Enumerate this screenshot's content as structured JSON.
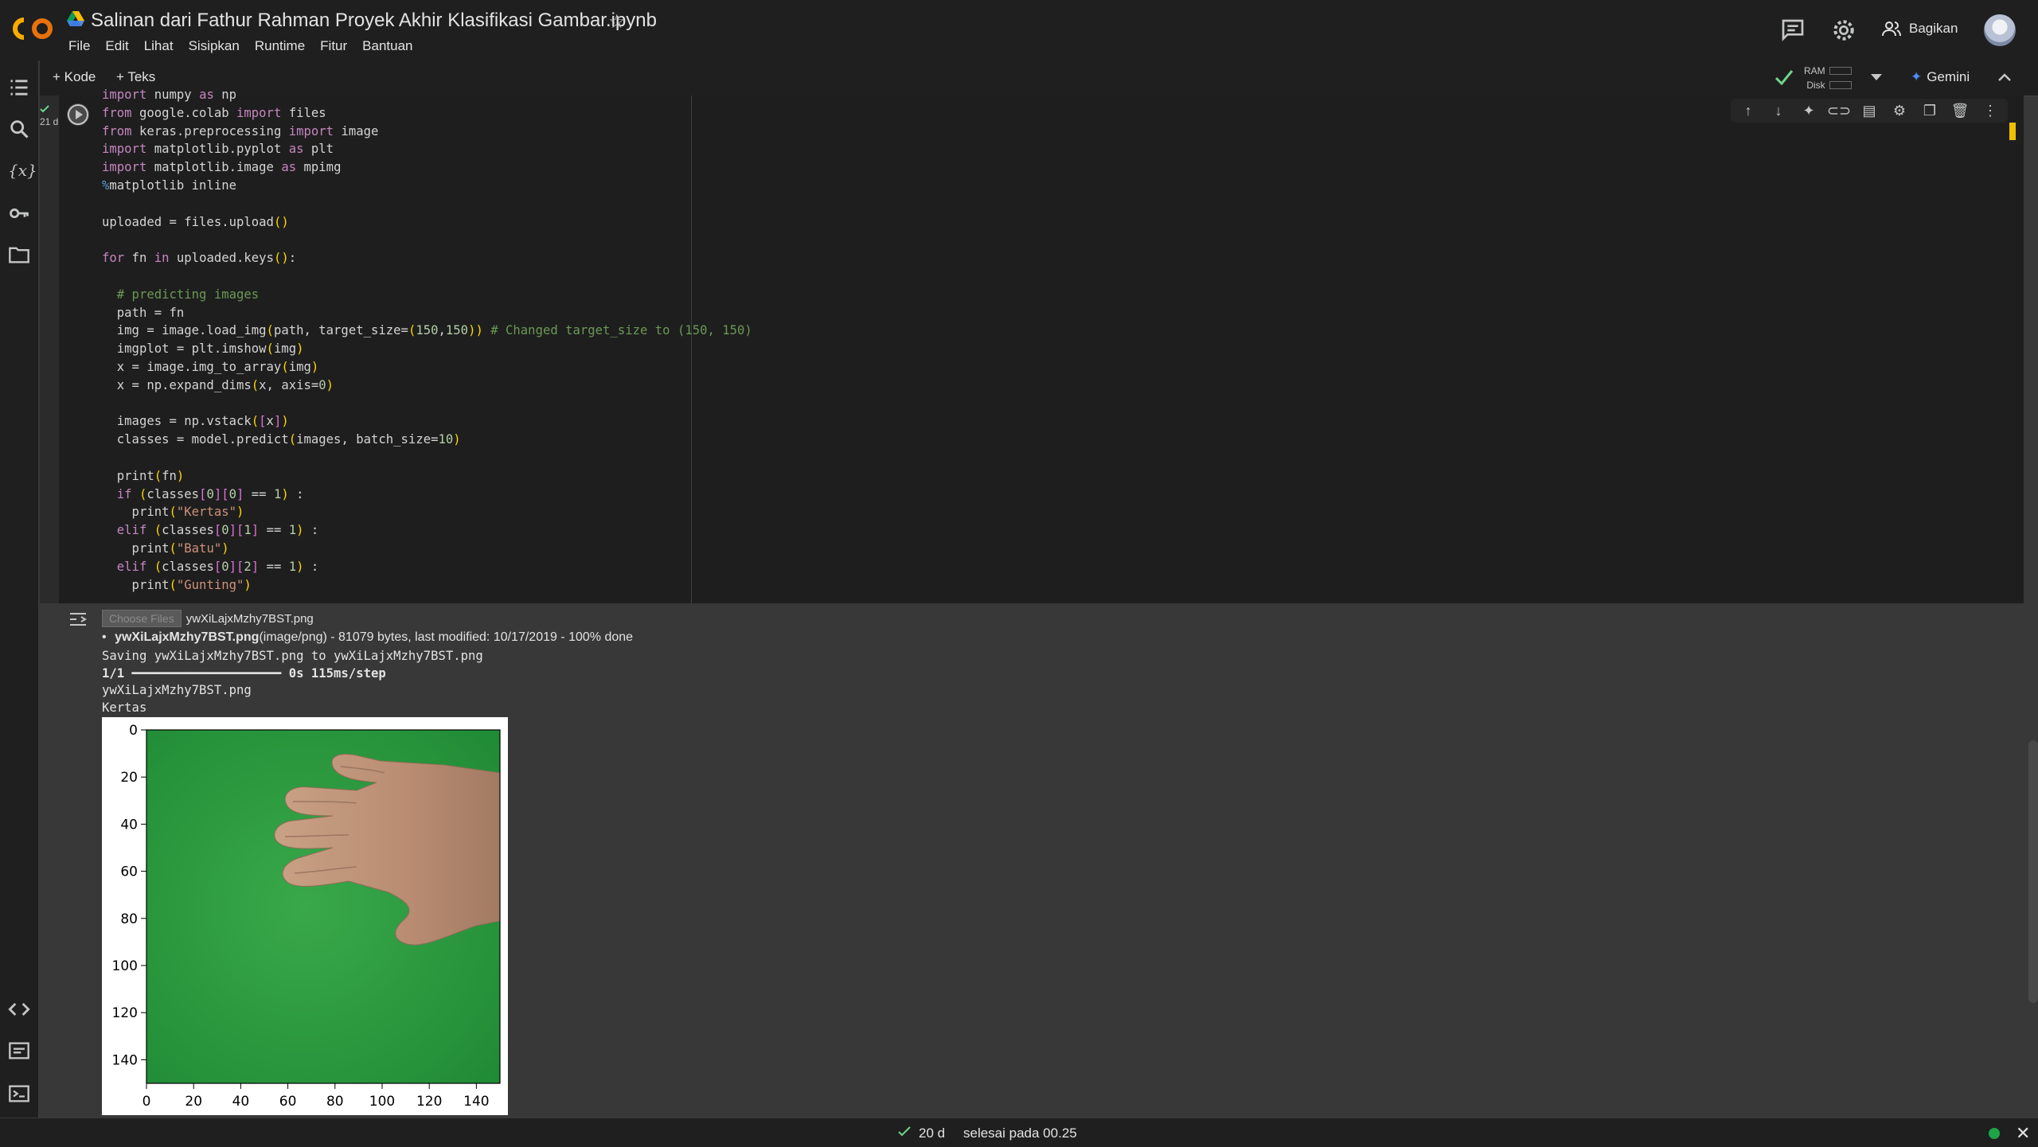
{
  "notebook_title": "Salinan dari Fathur Rahman Proyek Akhir Klasifikasi Gambar.ipynb",
  "menu": [
    "File",
    "Edit",
    "Lihat",
    "Sisipkan",
    "Runtime",
    "Fitur",
    "Bantuan"
  ],
  "header": {
    "share_label": "Bagikan"
  },
  "toolbar": {
    "add_code": "Kode",
    "add_text": "Teks",
    "ram_label": "RAM",
    "disk_label": "Disk",
    "gemini_label": "Gemini"
  },
  "cell": {
    "exec_label": "21 d",
    "code_lines": [
      "import numpy as np",
      "from google.colab import files",
      "from keras.preprocessing import image",
      "import matplotlib.pyplot as plt",
      "import matplotlib.image as mpimg",
      "%matplotlib inline",
      "",
      "uploaded = files.upload()",
      "",
      "for fn in uploaded.keys():",
      "",
      "  # predicting images",
      "  path = fn",
      "  img = image.load_img(path, target_size=(150,150)) # Changed target_size to (150, 150)",
      "  imgplot = plt.imshow(img)",
      "  x = image.img_to_array(img)",
      "  x = np.expand_dims(x, axis=0)",
      "",
      "  images = np.vstack([x])",
      "  classes = model.predict(images, batch_size=10)",
      "",
      "  print(fn)",
      "  if (classes[0][0] == 1) :",
      "    print(\"Kertas\")",
      "  elif (classes[0][1] == 1) :",
      "    print(\"Batu\")",
      "  elif (classes[0][2] == 1) :",
      "    print(\"Gunting\")"
    ]
  },
  "output": {
    "choose_files_label": "Choose Files",
    "chosen_file": "ywXiLajxMzhy7BST.png",
    "upload_filename": "ywXiLajxMzhy7BST.png",
    "upload_meta": "(image/png) - 81079 bytes, last modified: 10/17/2019 - 100% done",
    "saving_line": "Saving ywXiLajxMzhy7BST.png to ywXiLajxMzhy7BST.png",
    "progress_line": "1/1 ━━━━━━━━━━━━━━━━━━━━ 0s 115ms/step",
    "printed_fn": "ywXiLajxMzhy7BST.png",
    "printed_class": "Kertas"
  },
  "chart_data": {
    "type": "image",
    "title": "",
    "xlabel": "",
    "ylabel": "",
    "xlim": [
      0,
      150
    ],
    "ylim": [
      150,
      0
    ],
    "x_ticks": [
      0,
      20,
      40,
      60,
      80,
      100,
      120,
      140
    ],
    "y_ticks": [
      0,
      20,
      40,
      60,
      80,
      100,
      120,
      140
    ]
  },
  "status": {
    "check_label": "20 d",
    "completed_text": "selesai pada 00.25"
  },
  "colors": {
    "accent": "#f9ab00",
    "background": "#383838",
    "code_bg": "#1e1e1e",
    "image_green": "#2d9b3c"
  }
}
